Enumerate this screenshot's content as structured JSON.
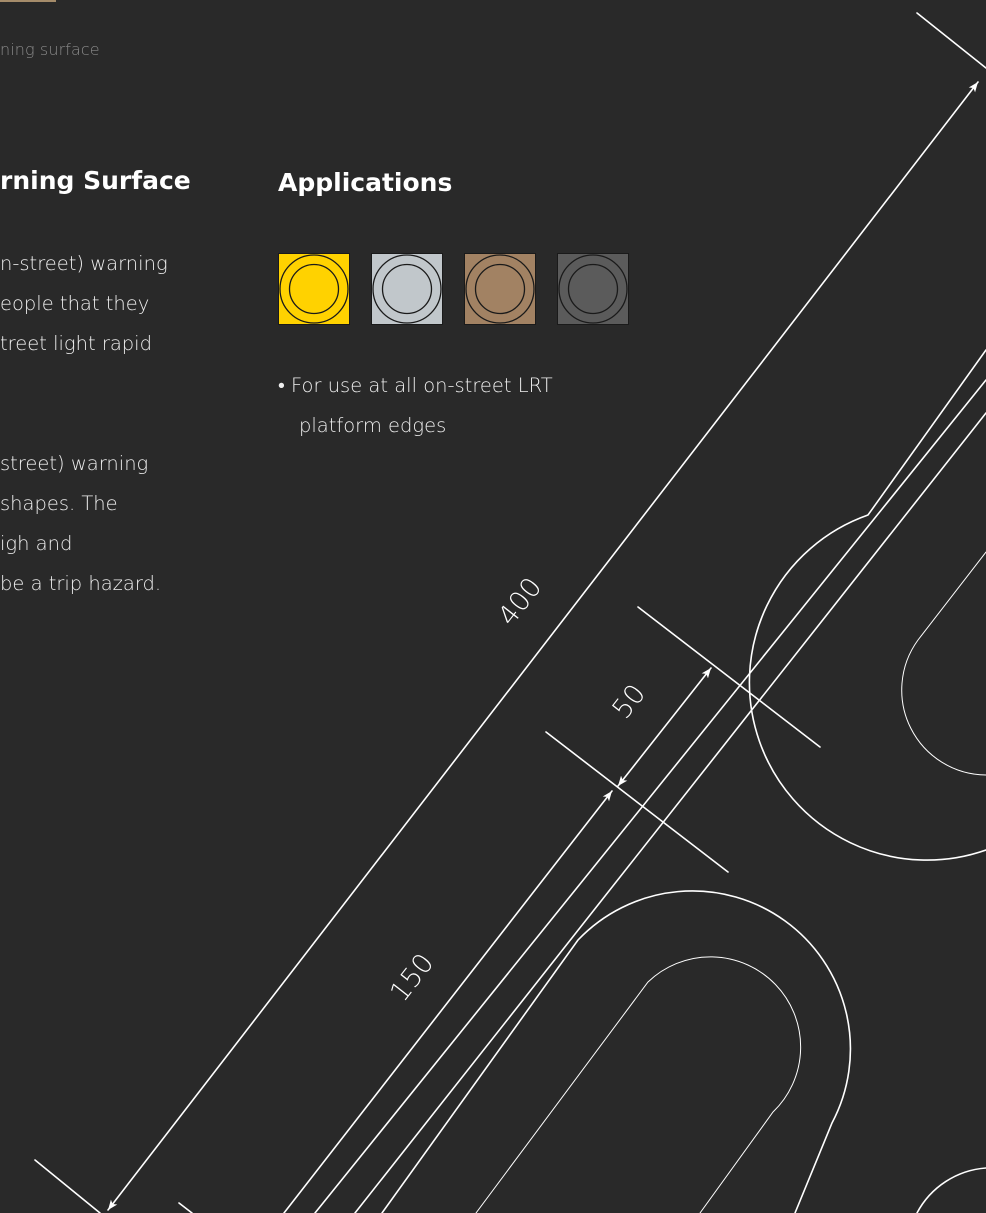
{
  "caption": "ning surface",
  "left_section": {
    "heading": "rning Surface",
    "paragraph1": [
      "n-street) warning",
      "eople that they",
      "treet light rapid"
    ],
    "paragraph2": [
      "street) warning",
      "shapes. The",
      "igh and",
      "be a trip hazard."
    ]
  },
  "applications": {
    "heading": "Applications",
    "swatches": [
      {
        "name": "yellow",
        "fill": "#ffd200",
        "ring": "#1a1a1a"
      },
      {
        "name": "light-grey",
        "fill": "#c1c7cb",
        "ring": "#1a1a1a"
      },
      {
        "name": "brown",
        "fill": "#a28263",
        "ring": "#1a1a1a"
      },
      {
        "name": "dark-grey",
        "fill": "#5b5b5b",
        "ring": "#1a1a1a"
      }
    ],
    "bullet": {
      "marker": "•",
      "line1": "For use at all on-street LRT",
      "line2": "platform edges"
    }
  },
  "dimensions": {
    "overall": "400",
    "gap": "50",
    "width": "150"
  },
  "colors": {
    "background": "#292929",
    "line": "#ffffff",
    "caption": "#8a8a8a"
  }
}
